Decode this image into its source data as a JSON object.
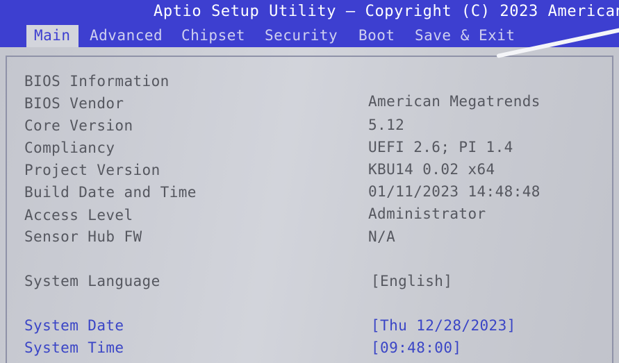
{
  "header": {
    "title": "Aptio Setup Utility – Copyright (C) 2023 American"
  },
  "tabs": [
    {
      "label": "Main",
      "active": true
    },
    {
      "label": "Advanced",
      "active": false
    },
    {
      "label": "Chipset",
      "active": false
    },
    {
      "label": "Security",
      "active": false
    },
    {
      "label": "Boot",
      "active": false
    },
    {
      "label": "Save & Exit",
      "active": false
    }
  ],
  "main": {
    "section_heading": "BIOS Information",
    "info": [
      {
        "label": "BIOS Vendor",
        "value": "American Megatrends"
      },
      {
        "label": "Core Version",
        "value": "5.12"
      },
      {
        "label": "Compliancy",
        "value": "UEFI 2.6; PI 1.4"
      },
      {
        "label": "Project Version",
        "value": "KBU14 0.02 x64"
      },
      {
        "label": "Build Date and Time",
        "value": "01/11/2023 14:48:48"
      },
      {
        "label": "Access Level",
        "value": "Administrator"
      },
      {
        "label": "Sensor Hub FW",
        "value": "N/A"
      }
    ],
    "settings": [
      {
        "label": "System Language",
        "value": "[English]"
      },
      {
        "label": "System Date",
        "value": "[Thu 12/28/2023]"
      },
      {
        "label": "System Time",
        "value": "[09:48:00]"
      }
    ]
  },
  "colors": {
    "header_bg": "#3d3fd0",
    "header_text": "#ffffff",
    "active_tab_bg": "#d3d5dc",
    "active_tab_text": "#3d3fd0",
    "content_bg": "#c9cbd3",
    "static_text": "#55575f",
    "setting_text": "#3a45c6"
  }
}
